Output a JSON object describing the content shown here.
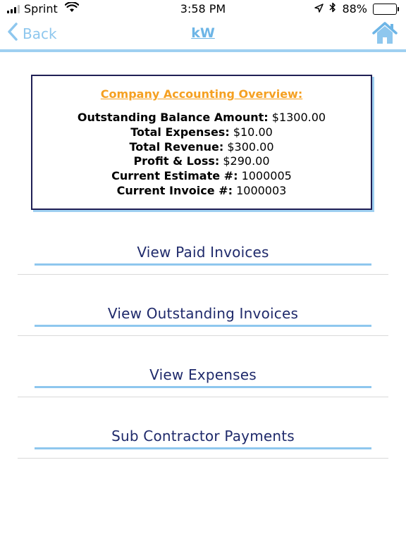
{
  "status_bar": {
    "carrier": "Sprint",
    "time": "3:58 PM",
    "battery_percent": "88%",
    "battery_level": 0.88,
    "icons": [
      "signal-icon",
      "wifi-icon",
      "location-arrow-icon",
      "bluetooth-icon",
      "battery-icon"
    ]
  },
  "nav": {
    "back_label": "Back",
    "title": "kW",
    "home_icon": "home-icon"
  },
  "overview": {
    "title": "Company Accounting Overview:",
    "lines": [
      {
        "label": "Outstanding Balance Amount:",
        "value": "$1300.00"
      },
      {
        "label": "Total Expenses:",
        "value": "$10.00"
      },
      {
        "label": "Total Revenue:",
        "value": "$300.00"
      },
      {
        "label": "Profit & Loss:",
        "value": "$290.00"
      },
      {
        "label": "Current Estimate #:",
        "value": "1000005"
      },
      {
        "label": "Current Invoice #:",
        "value": "1000003"
      }
    ]
  },
  "menu": {
    "items": [
      {
        "label": "View Paid Invoices"
      },
      {
        "label": "View Outstanding Invoices"
      },
      {
        "label": "View Expenses"
      },
      {
        "label": "Sub Contractor Payments"
      }
    ]
  },
  "colors": {
    "accent_blue": "#8ec7ee",
    "title_orange": "#f5a021",
    "menu_text": "#1f2a6b",
    "card_border": "#1f1f55"
  }
}
